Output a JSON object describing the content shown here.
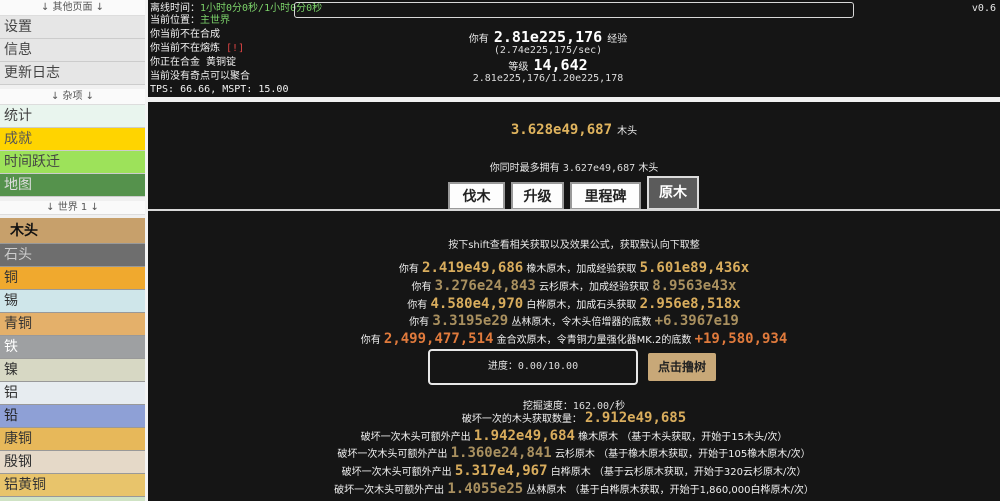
{
  "sidebar": {
    "other_pages_header": "↓ 其他页面 ↓",
    "other_pages": [
      {
        "label": "设置"
      },
      {
        "label": "信息"
      },
      {
        "label": "更新日志"
      }
    ],
    "misc_header": "↓ 杂项 ↓",
    "misc": [
      {
        "label": "统计",
        "color": "#e9f5ee",
        "text": "#444"
      },
      {
        "label": "成就",
        "color": "#ffd400",
        "text": "#555"
      },
      {
        "label": "时间跃迁",
        "color": "#9de25a",
        "text": "#444"
      },
      {
        "label": "地图",
        "color": "#55924c",
        "text": "#ddd"
      }
    ],
    "world_header": "↓ 世界 1 ↓",
    "resources": [
      {
        "label": "木头",
        "color": "#c7a06b",
        "text": "#111"
      },
      {
        "label": "石头",
        "color": "#6e6e6e",
        "text": "#ccc"
      },
      {
        "label": "铜",
        "color": "#f0a92e",
        "text": "#333"
      },
      {
        "label": "锡",
        "color": "#cfe6ea",
        "text": "#333"
      },
      {
        "label": "青铜",
        "color": "#e4b06a",
        "text": "#333"
      },
      {
        "label": "铁",
        "color": "#9ea0a2",
        "text": "#fff"
      },
      {
        "label": "镍",
        "color": "#d7d8c4",
        "text": "#333"
      },
      {
        "label": "铝",
        "color": "#e7ecf0",
        "text": "#333"
      },
      {
        "label": "铅",
        "color": "#8ea0d6",
        "text": "#222"
      },
      {
        "label": "康铜",
        "color": "#e7b85a",
        "text": "#333"
      },
      {
        "label": "殷钢",
        "color": "#e5d9c8",
        "text": "#333"
      },
      {
        "label": "铝黄铜",
        "color": "#e8c46b",
        "text": "#333"
      },
      {
        "label": "",
        "color": "#cfe3c4",
        "text": "#333"
      }
    ]
  },
  "status": {
    "offline_label": "离线时间：",
    "offline_value": "1小时0分0秒/1小时0分0秒",
    "location_label": "当前位置：",
    "location_value": "主世界",
    "alloy_status": "你当前不在合成",
    "smelt_status": "你当前不在熔炼",
    "smelt_warning": "[!]",
    "alloying_label": "你正在合金",
    "alloying_value": "黄铜锭",
    "singularity": "当前没有奇点可以聚合",
    "tps": "TPS: 66.66, MSPT: 15.00",
    "version": "v0.6"
  },
  "xp": {
    "prefix": "你有",
    "amount": "2.81e225,176",
    "suffix": "经验",
    "rate": "(2.74e225,175/sec)",
    "level_label": "等级",
    "level": "14,642",
    "progress": "2.81e225,176/1.20e225,178"
  },
  "wood": {
    "amount": "3.628e49,687",
    "unit": "木头",
    "max_prefix": "你同时最多拥有",
    "max_amount": "3.627e49,687",
    "max_unit": "木头"
  },
  "tabs": [
    {
      "label": "伐木",
      "active": false
    },
    {
      "label": "升级",
      "active": false
    },
    {
      "label": "里程碑",
      "active": false
    },
    {
      "label": "原木",
      "active": true
    }
  ],
  "hint": "按下shift查看相关获取以及效果公式，获取默认向下取整",
  "logs": [
    {
      "prefix": "你有",
      "amount": "2.419e49,686",
      "mid": "橡木原木，加成经验获取",
      "effect": "5.601e89,436x",
      "amount_style": "gold",
      "effect_style": "gold"
    },
    {
      "prefix": "你有",
      "amount": "3.276e24,843",
      "mid": "云杉原木，加成经验获取",
      "effect": "8.9563e43x",
      "amount_style": "dim",
      "effect_style": "dim"
    },
    {
      "prefix": "你有",
      "amount": "4.580e4,970",
      "mid": "白桦原木，加成石头获取",
      "effect": "2.956e8,518x",
      "amount_style": "gold",
      "effect_style": "gold"
    },
    {
      "prefix": "你有",
      "amount": "3.3195e29",
      "mid": "丛林原木，令木头倍增器的底数",
      "effect": "+6.3967e19",
      "amount_style": "dim",
      "effect_style": "dim"
    },
    {
      "prefix": "你有",
      "amount": "2,499,477,514",
      "mid": "金合欢原木，令青铜力量强化器MK.2的底数",
      "effect": "+19,580,934",
      "amount_style": "orange",
      "effect_style": "orange"
    }
  ],
  "chop": {
    "progress_label": "进度：",
    "progress_value": "0.00/10.00",
    "progress_fraction": 0,
    "button": "点击撸树"
  },
  "mining": {
    "speed_label": "挖掘速度：",
    "speed_value": "162.00/秒",
    "break_label": "破坏一次的木头获取数量：",
    "break_value": "2.912e49,685"
  },
  "extras": [
    {
      "prefix": "破坏一次木头可额外产出",
      "amount": "1.942e49,684",
      "unit": "橡木原木",
      "note": "（基于木头获取，开始于15木头/次）",
      "style": "gold"
    },
    {
      "prefix": "破坏一次木头可额外产出",
      "amount": "1.360e24,841",
      "unit": "云杉原木",
      "note": "（基于橡木原木获取，开始于105橡木原木/次）",
      "style": "dim"
    },
    {
      "prefix": "破坏一次木头可额外产出",
      "amount": "5.317e4,967",
      "unit": "白桦原木",
      "note": "（基于云杉原木获取，开始于320云杉原木/次）",
      "style": "gold"
    },
    {
      "prefix": "破坏一次木头可额外产出",
      "amount": "1.4055e25",
      "unit": "丛林原木",
      "note": "（基于白桦原木获取，开始于1,860,000白桦原木/次）",
      "style": "dim"
    }
  ]
}
